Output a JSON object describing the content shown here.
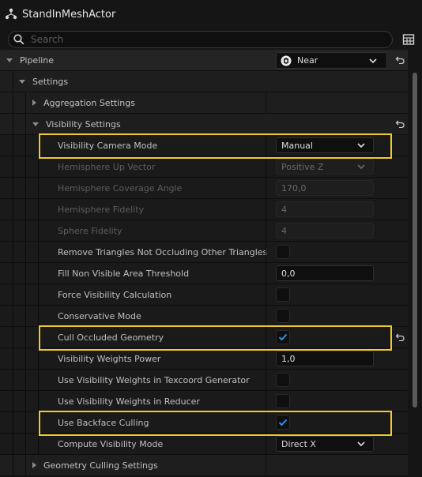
{
  "window": {
    "title": "StandInMeshActor"
  },
  "search": {
    "placeholder": "Search"
  },
  "pipeline": {
    "label": "Pipeline",
    "value": "Near"
  },
  "settings": {
    "label": "Settings"
  },
  "aggregation": {
    "label": "Aggregation Settings"
  },
  "visibility": {
    "label": "Visibility Settings"
  },
  "props": {
    "camera_mode": {
      "label": "Visibility Camera Mode",
      "value": "Manual"
    },
    "hemi_up": {
      "label": "Hemisphere Up Vector",
      "value": "Positive Z"
    },
    "hemi_angle": {
      "label": "Hemisphere Coverage Angle",
      "value": "170,0"
    },
    "hemi_fidelity": {
      "label": "Hemisphere Fidelity",
      "value": "4"
    },
    "sphere_fidelity": {
      "label": "Sphere Fidelity",
      "value": "4"
    },
    "remove_tris": {
      "label": "Remove Triangles Not Occluding Other Triangles",
      "checked": false
    },
    "fill_threshold": {
      "label": "Fill Non Visible Area Threshold",
      "value": "0,0"
    },
    "force_calc": {
      "label": "Force Visibility Calculation",
      "checked": false
    },
    "conservative": {
      "label": "Conservative Mode",
      "checked": false
    },
    "cull_occluded": {
      "label": "Cull Occluded Geometry",
      "checked": true
    },
    "weights_power": {
      "label": "Visibility Weights Power",
      "value": "1,0"
    },
    "weights_texcoord": {
      "label": "Use Visibility Weights in Texcoord Generator",
      "checked": false
    },
    "weights_reducer": {
      "label": "Use Visibility Weights in Reducer",
      "checked": false
    },
    "backface": {
      "label": "Use Backface Culling",
      "checked": true
    },
    "compute_mode": {
      "label": "Compute Visibility Mode",
      "value": "Direct X"
    }
  },
  "geometry_culling": {
    "label": "Geometry Culling Settings"
  },
  "colors": {
    "highlight": "#f2c92e",
    "check": "#2f8fe8"
  }
}
